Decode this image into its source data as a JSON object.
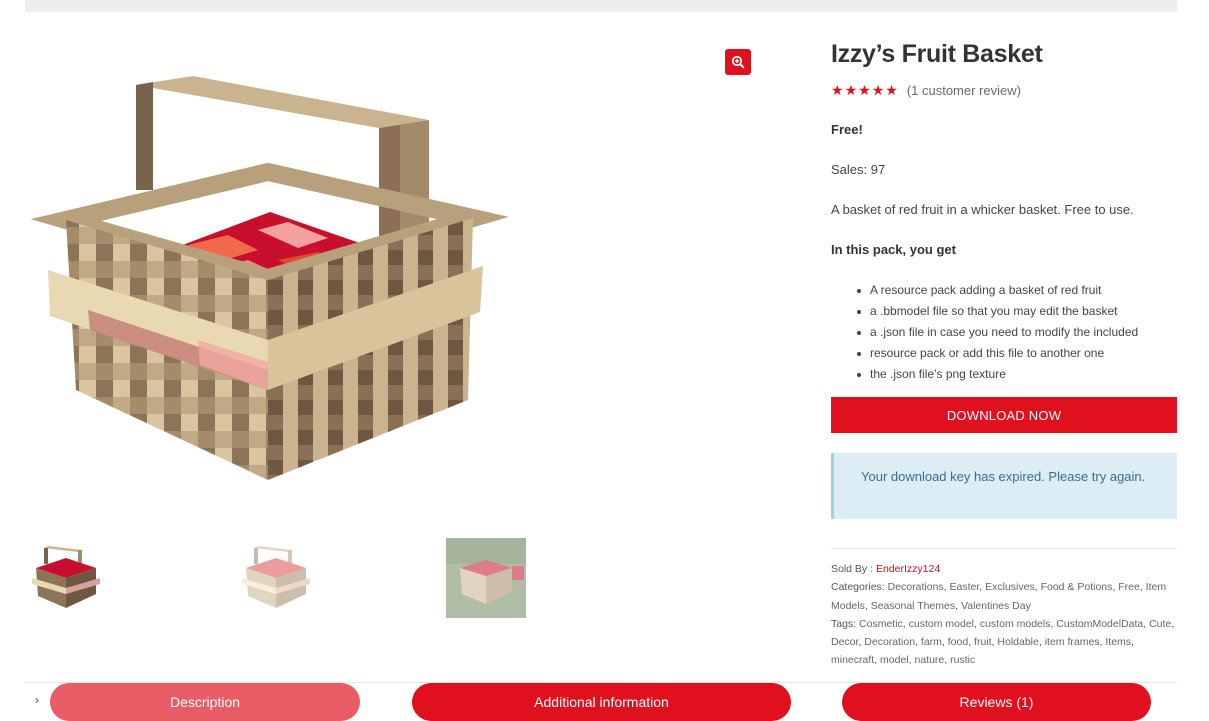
{
  "product": {
    "title": "Izzy’s Fruit Basket",
    "rating": 5,
    "review_link": "(1 customer review)",
    "price": "Free!",
    "sales": "Sales: 97",
    "description": "A basket of red fruit in a whicker basket. Free to use.",
    "pack_heading": "In this pack, you get",
    "pack_items": [
      "A resource pack adding a basket of red fruit",
      "a .bbmodel file so that you may edit the basket",
      "a .json file in case you need to modify the included",
      "resource pack or add this file to another one",
      "the .json file’s png texture"
    ],
    "download_label": "DOWNLOAD NOW",
    "notice": "Your download key has expired. Please try again."
  },
  "meta": {
    "sold_by_label": "Sold By :",
    "vendor": "EnderIzzy124",
    "categories_label": "Categories:",
    "categories": [
      "Decorations",
      "Easter",
      "Exclusives",
      "Food & Potions",
      "Free",
      "Item Models",
      "Seasonal Themes",
      "Valentines Day"
    ],
    "tags_label": "Tags:",
    "tags": [
      "Cosmetic",
      "custom model",
      "custom models",
      "CustomModelData",
      "Cute",
      "Decor",
      "Decoration",
      "farm",
      "food",
      "fruit",
      "Holdable",
      "item frames",
      "Items",
      "minecraft",
      "model",
      "nature",
      "rustic"
    ]
  },
  "tabs": {
    "description": "Description",
    "additional": "Additional information",
    "reviews": "Reviews (1)"
  },
  "icons": {
    "zoom": "magnify-plus-icon",
    "star": "star-icon",
    "chevron": "chevron-right-icon"
  },
  "colors": {
    "accent": "#e0101f",
    "accent_light": "#e95c66",
    "notice_bg": "#dcedf5",
    "notice_text": "#3a6f8a"
  }
}
